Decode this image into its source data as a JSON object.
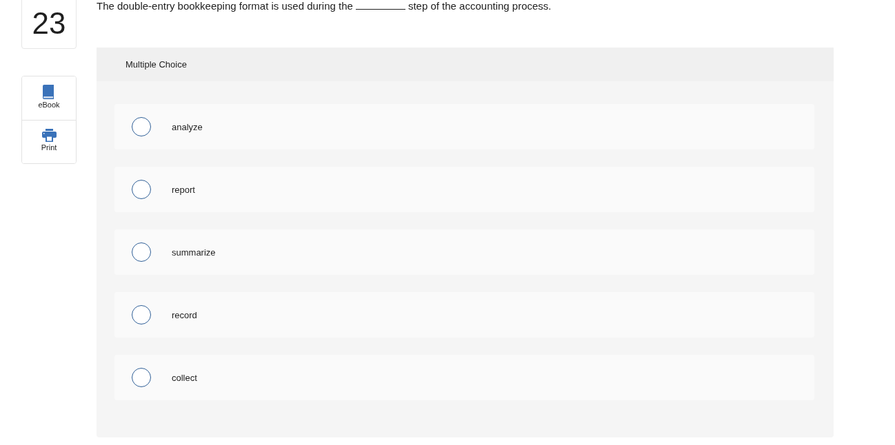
{
  "question_number": "23",
  "tools": [
    {
      "kind": "ebook",
      "label": "eBook"
    },
    {
      "kind": "print",
      "label": "Print"
    }
  ],
  "question": {
    "parts": [
      {
        "kind": "text",
        "text": "The double-entry bookkeeping format is used during the"
      },
      {
        "kind": "blank"
      },
      {
        "kind": "text",
        "text": "step of the accounting process."
      }
    ]
  },
  "answer_panel": {
    "title": "Multiple Choice",
    "options": [
      {
        "label": "analyze",
        "selected": false
      },
      {
        "label": "report",
        "selected": false
      },
      {
        "label": "summarize",
        "selected": false
      },
      {
        "label": "record",
        "selected": false
      },
      {
        "label": "collect",
        "selected": false
      }
    ]
  }
}
